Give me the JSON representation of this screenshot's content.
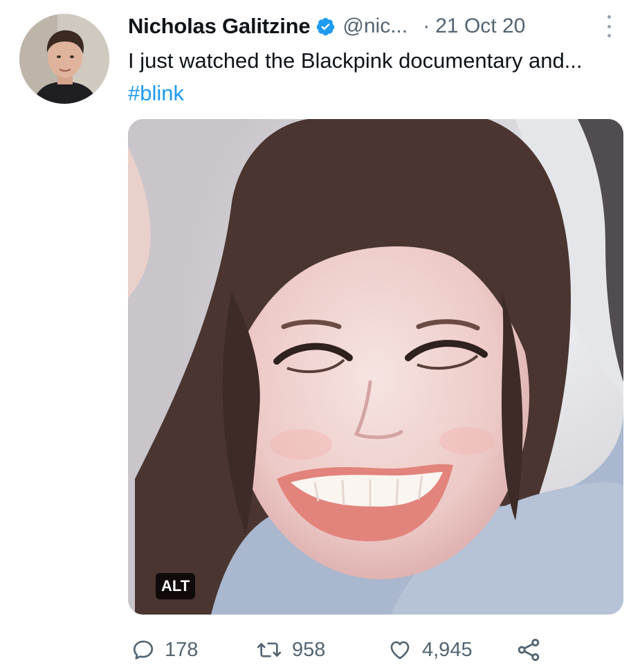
{
  "tweet": {
    "display_name": "Nicholas Galitzine",
    "handle": "@nic...",
    "separator": "·",
    "date": "21 Oct 20",
    "text_line": "I just watched the Blackpink documentary and...",
    "hashtag": "#blink",
    "verified": true
  },
  "media": {
    "alt_label": "ALT"
  },
  "actions": {
    "reply_icon": "reply-icon",
    "reply_count": "178",
    "retweet_icon": "retweet-icon",
    "retweet_count": "958",
    "like_icon": "heart-icon",
    "like_count": "4,945",
    "share_icon": "share-icon"
  },
  "colors": {
    "link": "#1d9bf0",
    "secondary_text": "#536471",
    "primary_text": "#0f1419",
    "verified_badge": "#1d9bf0"
  }
}
